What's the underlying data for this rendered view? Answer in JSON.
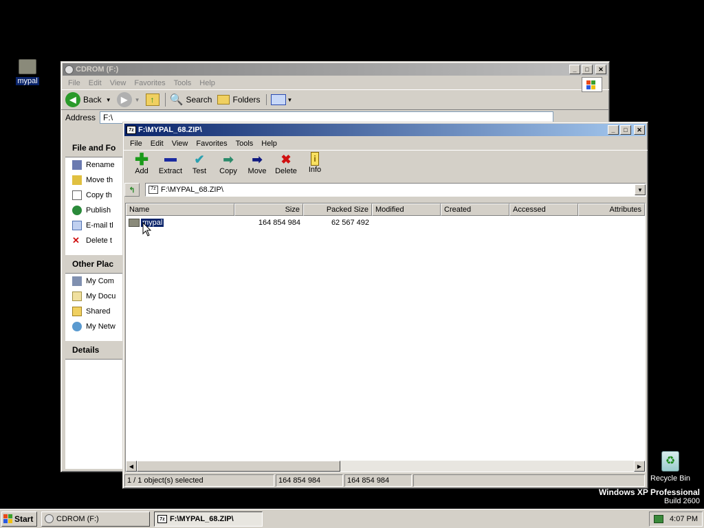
{
  "desktop": {
    "icon_mypal": "mypal",
    "icon_recycle": "Recycle Bin",
    "watermark_line1": "Windows XP Professional",
    "watermark_line2": "Build 2600"
  },
  "explorer": {
    "title": "CDROM (F:)",
    "menu": [
      "File",
      "Edit",
      "View",
      "Favorites",
      "Tools",
      "Help"
    ],
    "toolbar": {
      "back": "Back",
      "search": "Search",
      "folders": "Folders"
    },
    "address_label": "Address",
    "address_value": "F:\\",
    "taskpane": {
      "file_tasks_title": "File and Fo",
      "file_tasks": [
        "Rename",
        "Move th",
        "Copy th",
        "Publish",
        "E-mail tl",
        "Delete t"
      ],
      "other_places_title": "Other Plac",
      "other_places": [
        "My Com",
        "My Docu",
        "Shared",
        "My Netw"
      ],
      "details_title": "Details"
    }
  },
  "zip": {
    "title": "F:\\MYPAL_68.ZIP\\",
    "menu": [
      "File",
      "Edit",
      "View",
      "Favorites",
      "Tools",
      "Help"
    ],
    "tools": [
      {
        "label": "Add",
        "icon": "add-icon",
        "color": "#1a9a1a"
      },
      {
        "label": "Extract",
        "icon": "extract-icon",
        "color": "#1a2aa0"
      },
      {
        "label": "Test",
        "icon": "test-icon",
        "color": "#2aa0b0"
      },
      {
        "label": "Copy",
        "icon": "copy-icon",
        "color": "#2a8a6a"
      },
      {
        "label": "Move",
        "icon": "move-icon",
        "color": "#101a80"
      },
      {
        "label": "Delete",
        "icon": "delete-icon",
        "color": "#d01010"
      },
      {
        "label": "Info",
        "icon": "info-icon",
        "color": "#c0a000"
      }
    ],
    "path": "F:\\MYPAL_68.ZIP\\",
    "columns": [
      "Name",
      "Size",
      "Packed Size",
      "Modified",
      "Created",
      "Accessed",
      "Attributes"
    ],
    "rows": [
      {
        "name": "mypal",
        "size": "164 854 984",
        "packed": "62 567 492",
        "modified": "",
        "created": "",
        "accessed": "",
        "attributes": ""
      }
    ],
    "status": {
      "selected": "1 / 1 object(s) selected",
      "size": "164 854 984",
      "packed": "164 854 984"
    }
  },
  "taskbar": {
    "start": "Start",
    "tasks": [
      "CDROM (F:)",
      "F:\\MYPAL_68.ZIP\\"
    ],
    "clock": "4:07 PM"
  }
}
